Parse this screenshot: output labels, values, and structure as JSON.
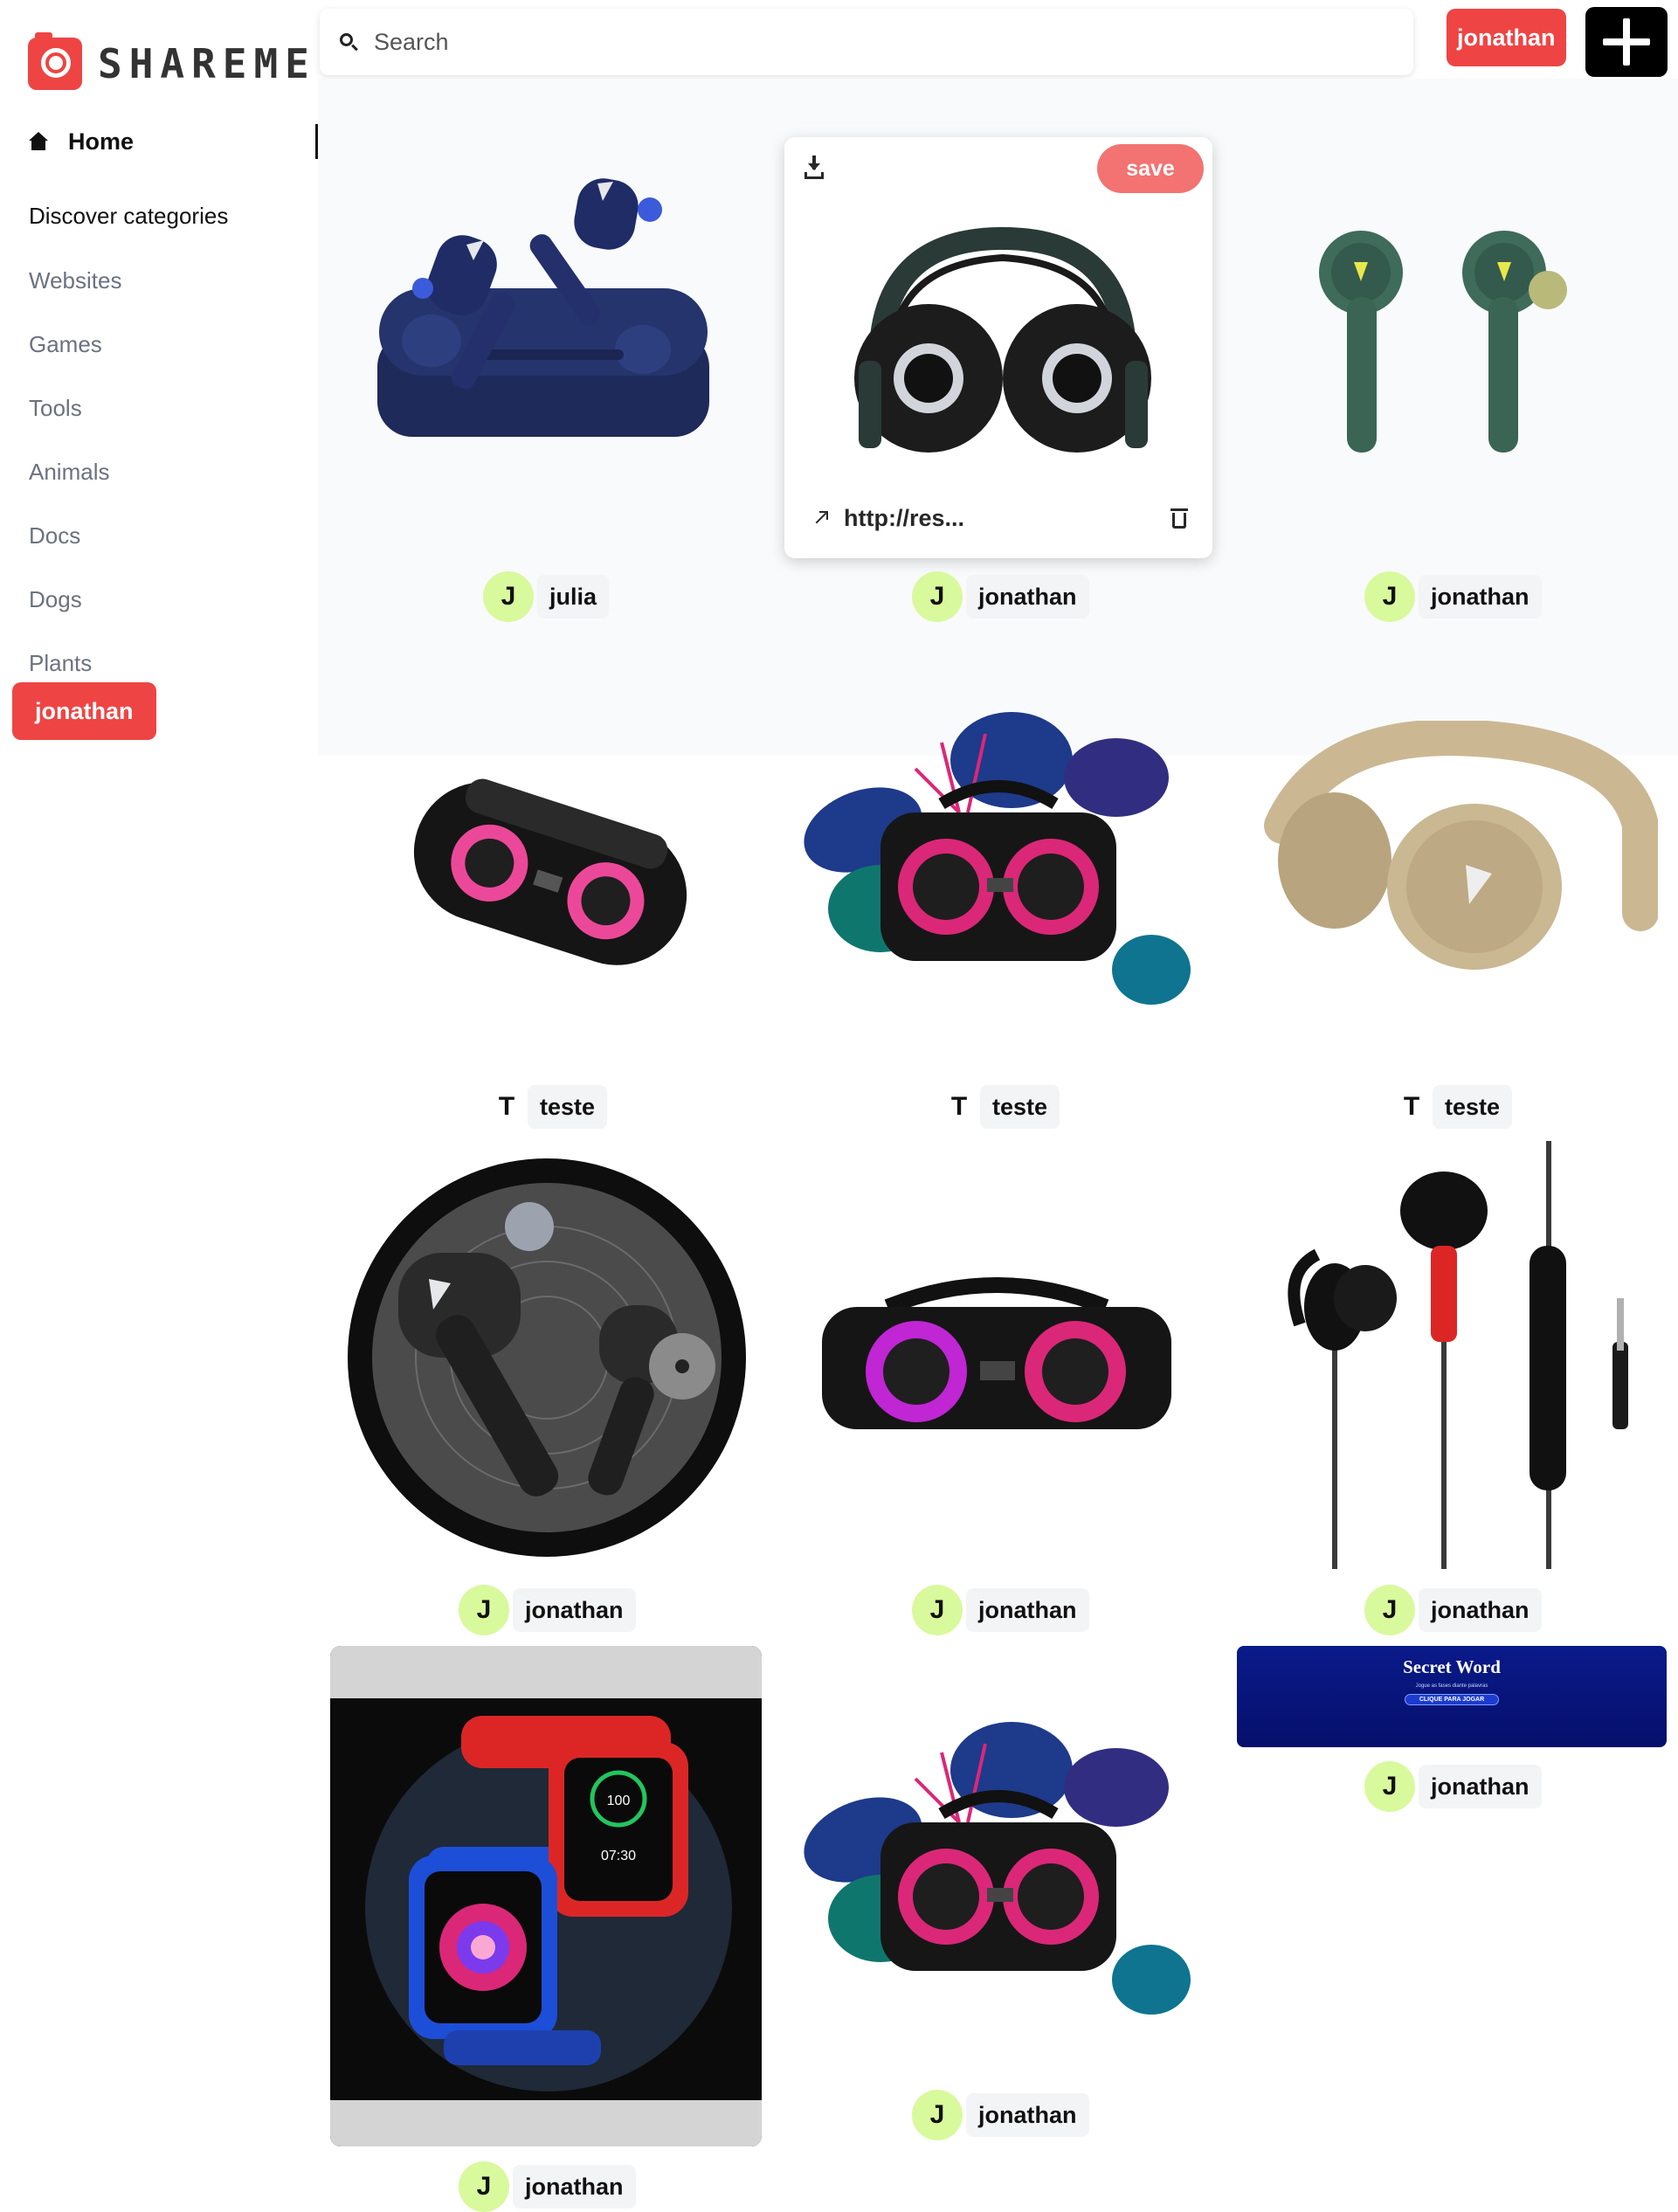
{
  "app": {
    "logo_text": "SHAREME",
    "nav": {
      "home_label": "Home",
      "discover_label": "Discover categories",
      "categories": [
        "Websites",
        "Games",
        "Tools",
        "Animals",
        "Docs",
        "Dogs",
        "Plants"
      ],
      "user_label": "jonathan"
    },
    "header": {
      "search_placeholder": "Search",
      "user_label": "jonathan",
      "add_icon": "plus-icon"
    },
    "accent_color": "#ef4444",
    "avatar_color": "#d9f99d"
  },
  "pins": [
    {
      "image": "earbuds-case",
      "user_initial": "J",
      "user_name": "julia"
    },
    {
      "image": "headphones-folding",
      "user_initial": "J",
      "user_name": "jonathan",
      "hover": {
        "save_label": "save",
        "link_text": "http://res...",
        "download_icon": "download-icon",
        "link_icon": "arrow-up-right-icon",
        "delete_icon": "trash-icon"
      }
    },
    {
      "image": "green-earbuds",
      "user_initial": "J",
      "user_name": "jonathan"
    },
    {
      "image": "bluetooth-speaker",
      "user_initial": "T",
      "user_name": "teste"
    },
    {
      "image": "party-speaker-leaves",
      "user_initial": "T",
      "user_name": "teste"
    },
    {
      "image": "beige-headphones",
      "user_initial": "T",
      "user_name": "teste"
    },
    {
      "image": "earbuds-disc",
      "user_initial": "J",
      "user_name": "jonathan"
    },
    {
      "image": "party-speaker",
      "user_initial": "J",
      "user_name": "jonathan"
    },
    {
      "image": "wired-earphones",
      "user_initial": "J",
      "user_name": "jonathan"
    },
    {
      "image": "smartwatches",
      "user_initial": "J",
      "user_name": "jonathan",
      "watch_text": [
        "100",
        "07:30"
      ]
    },
    {
      "image": "party-speaker-leaves",
      "user_initial": "J",
      "user_name": "jonathan"
    },
    {
      "image": "secret-word-site",
      "user_initial": "J",
      "user_name": "jonathan",
      "site": {
        "title": "Secret Word",
        "subtitle": "Jogue as fases diante palavras",
        "button": "CLIQUE PARA JOGAR"
      }
    }
  ]
}
